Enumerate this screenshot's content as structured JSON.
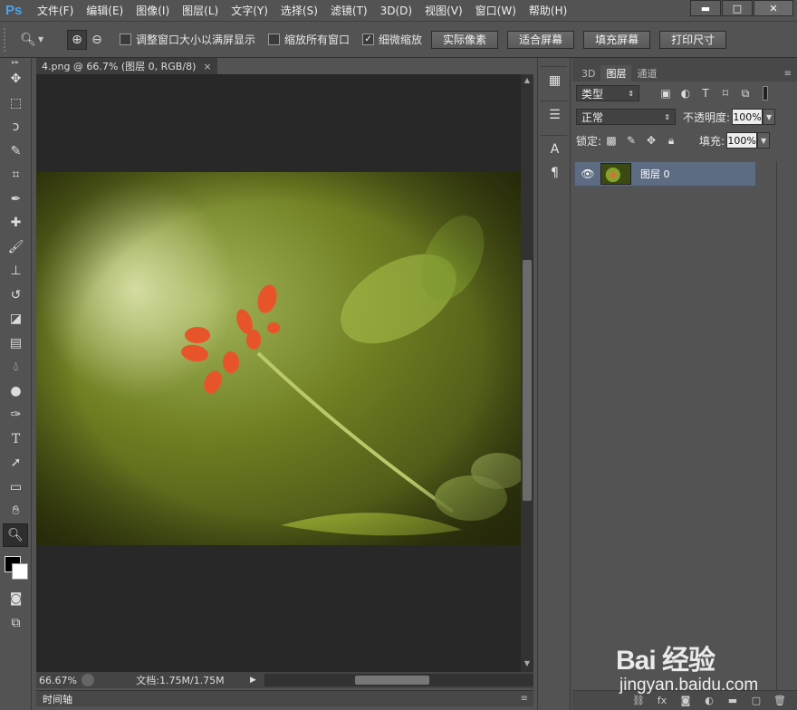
{
  "app": {
    "logo": "Ps"
  },
  "menu": [
    "文件(F)",
    "编辑(E)",
    "图像(I)",
    "图层(L)",
    "文字(Y)",
    "选择(S)",
    "滤镜(T)",
    "3D(D)",
    "视图(V)",
    "窗口(W)",
    "帮助(H)"
  ],
  "window_controls": {
    "minimize": "▬",
    "maximize": "□",
    "close": "✕"
  },
  "options": {
    "resize_windows": {
      "label": "调整窗口大小以满屏显示",
      "checked": false
    },
    "zoom_all": {
      "label": "缩放所有窗口",
      "checked": false
    },
    "scrubby_zoom": {
      "label": "细微缩放",
      "checked": true
    },
    "actual_pixels": "实际像素",
    "fit_screen": "适合屏幕",
    "fill_screen": "填充屏幕",
    "print_size": "打印尺寸"
  },
  "document": {
    "tab_title": "4.png @ 66.7% (图层 0, RGB/8)",
    "close": "×",
    "zoom": "66.67%",
    "doc_info": "文档:1.75M/1.75M"
  },
  "timeline": {
    "label": "时间轴"
  },
  "layers_panel": {
    "tabs": [
      "3D",
      "图层",
      "通道"
    ],
    "filter_kind": "类型",
    "blend_mode": "正常",
    "opacity_label": "不透明度:",
    "opacity_value": "100%",
    "lock_label": "锁定:",
    "fill_label": "填充:",
    "fill_value": "100%",
    "layers": [
      {
        "name": "图层 0",
        "visible": true
      }
    ]
  },
  "watermark": {
    "brand": "Bai 经验",
    "url": "jingyan.baidu.com"
  },
  "colors": {
    "foreground": "#000000",
    "background": "#ffffff",
    "selected_layer": "#5d6c82"
  }
}
